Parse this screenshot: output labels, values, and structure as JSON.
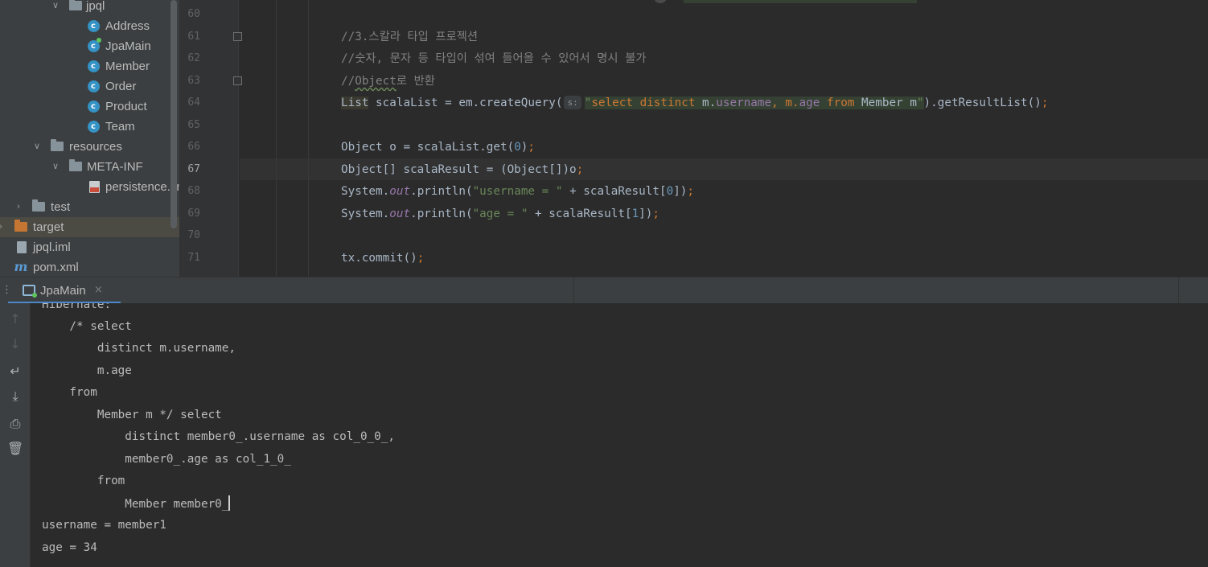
{
  "project_tree": {
    "items": [
      {
        "label": "jpql",
        "icon": "package-folder-icon"
      },
      {
        "label": "Address",
        "icon": "class-icon"
      },
      {
        "label": "JpaMain",
        "icon": "runnable-class-icon"
      },
      {
        "label": "Member",
        "icon": "class-icon"
      },
      {
        "label": "Order",
        "icon": "class-icon"
      },
      {
        "label": "Product",
        "icon": "class-icon"
      },
      {
        "label": "Team",
        "icon": "class-icon"
      },
      {
        "label": "resources",
        "icon": "resources-folder-icon"
      },
      {
        "label": "META-INF",
        "icon": "folder-icon"
      },
      {
        "label": "persistence.xml",
        "icon": "xml-file-icon"
      },
      {
        "label": "test",
        "icon": "folder-icon"
      },
      {
        "label": "target",
        "icon": "excluded-folder-icon"
      },
      {
        "label": "jpql.iml",
        "icon": "module-file-icon"
      },
      {
        "label": "pom.xml",
        "icon": "maven-icon"
      }
    ],
    "class_icon_letter": "c"
  },
  "editor": {
    "line_numbers": [
      "60",
      "61",
      "62",
      "63",
      "64",
      "65",
      "66",
      "67",
      "68",
      "69",
      "70",
      "71"
    ],
    "current_line": "67",
    "code": {
      "l61": "//3.스칼라 타입 프로젝션",
      "l62": "//숫자, 문자 등 타입이 섞여 들어올 수 있어서 명시 불가",
      "l63_a": "//",
      "l63_b": "Object",
      "l63_c": "로 반환",
      "l64_type": "List",
      "l64_a": " scalaList = em.createQuery(",
      "l64_hint": "s:",
      "l64_q1": "\"",
      "l64_kw1": "select distinct",
      "l64_m1": " m.",
      "l64_f1": "username",
      "l64_comma": ", m.",
      "l64_f2": "age",
      "l64_kw2": " from",
      "l64_ent": " Member m",
      "l64_q2": "\"",
      "l64_b": ").getResultList()",
      "l64_semi": ";",
      "l66_a": "Object o = scalaList.get(",
      "l66_n": "0",
      "l66_b": ")",
      "l66_semi": ";",
      "l67_a": "Object[] scalaResult = (Object[])o",
      "l67_semi": ";",
      "l68_a": "System.",
      "l68_out": "out",
      "l68_b": ".println(",
      "l68_s": "\"username = \"",
      "l68_c": " + scalaResult[",
      "l68_n": "0",
      "l68_d": "])",
      "l68_semi": ";",
      "l69_a": "System.",
      "l69_out": "out",
      "l69_b": ".println(",
      "l69_s": "\"age = \"",
      "l69_c": " + scalaResult[",
      "l69_n": "1",
      "l69_d": "])",
      "l69_semi": ";",
      "l71_a": "tx.commit()",
      "l71_semi": ";"
    }
  },
  "run_window": {
    "tab_label": "JpaMain",
    "tab_close": "×",
    "toolbar": [
      {
        "icon": "up-arrow-icon"
      },
      {
        "icon": "down-arrow-icon"
      },
      {
        "icon": "soft-wrap-icon"
      },
      {
        "icon": "scroll-to-end-icon"
      },
      {
        "icon": "print-icon"
      },
      {
        "icon": "trash-icon"
      }
    ],
    "console_lines": [
      "Hibernate:",
      "    /* select",
      "        distinct m.username,",
      "        m.age ",
      "    from",
      "        Member m */ select",
      "            distinct member0_.username as col_0_0_,",
      "            member0_.age as col_1_0_ ",
      "        from",
      "            Member member0_",
      "username = member1",
      "age = 34"
    ]
  }
}
